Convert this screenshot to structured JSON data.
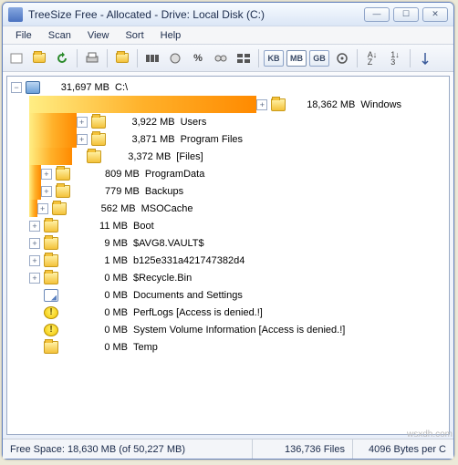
{
  "window": {
    "title": "TreeSize Free - Allocated - Drive: Local Disk (C:)"
  },
  "menu": {
    "file": "File",
    "scan": "Scan",
    "view": "View",
    "sort": "Sort",
    "help": "Help"
  },
  "toolbar": {
    "units": {
      "kb": "KB",
      "mb": "MB",
      "gb": "GB"
    }
  },
  "root": {
    "size": "31,697 MB",
    "name": "C:\\"
  },
  "items": [
    {
      "size": "18,362 MB",
      "name": "Windows",
      "icon": "folder",
      "expand": "+",
      "bar_pct": 58
    },
    {
      "size": "3,922 MB",
      "name": "Users",
      "icon": "folder",
      "expand": "+",
      "bar_pct": 12
    },
    {
      "size": "3,871 MB",
      "name": "Program Files",
      "icon": "folder",
      "expand": "+",
      "bar_pct": 12
    },
    {
      "size": "3,372 MB",
      "name": "[Files]",
      "icon": "folder",
      "expand": "",
      "bar_pct": 11
    },
    {
      "size": "809 MB",
      "name": "ProgramData",
      "icon": "folder",
      "expand": "+",
      "bar_pct": 3
    },
    {
      "size": "779 MB",
      "name": "Backups",
      "icon": "folder",
      "expand": "+",
      "bar_pct": 3
    },
    {
      "size": "562 MB",
      "name": "MSOCache",
      "icon": "folder",
      "expand": "+",
      "bar_pct": 2
    },
    {
      "size": "11 MB",
      "name": "Boot",
      "icon": "folder",
      "expand": "+",
      "bar_pct": 0
    },
    {
      "size": "9 MB",
      "name": "$AVG8.VAULT$",
      "icon": "folder",
      "expand": "+",
      "bar_pct": 0
    },
    {
      "size": "1 MB",
      "name": "b125e331a421747382d4",
      "icon": "folder",
      "expand": "+",
      "bar_pct": 0
    },
    {
      "size": "0 MB",
      "name": "$Recycle.Bin",
      "icon": "folder",
      "expand": "+",
      "bar_pct": 0
    },
    {
      "size": "0 MB",
      "name": "Documents and Settings",
      "icon": "link",
      "expand": "",
      "bar_pct": 0
    },
    {
      "size": "0 MB",
      "name": "PerfLogs  [Access is denied.!]",
      "icon": "warn",
      "expand": "",
      "bar_pct": 0
    },
    {
      "size": "0 MB",
      "name": "System Volume Information  [Access is denied.!]",
      "icon": "warn",
      "expand": "",
      "bar_pct": 0
    },
    {
      "size": "0 MB",
      "name": "Temp",
      "icon": "folder",
      "expand": "",
      "bar_pct": 0
    }
  ],
  "status": {
    "free": "Free Space: 18,630 MB  (of 50,227 MB)",
    "files": "136,736  Files",
    "cluster": "4096 Bytes per C"
  },
  "watermark": "wsxdh.com"
}
